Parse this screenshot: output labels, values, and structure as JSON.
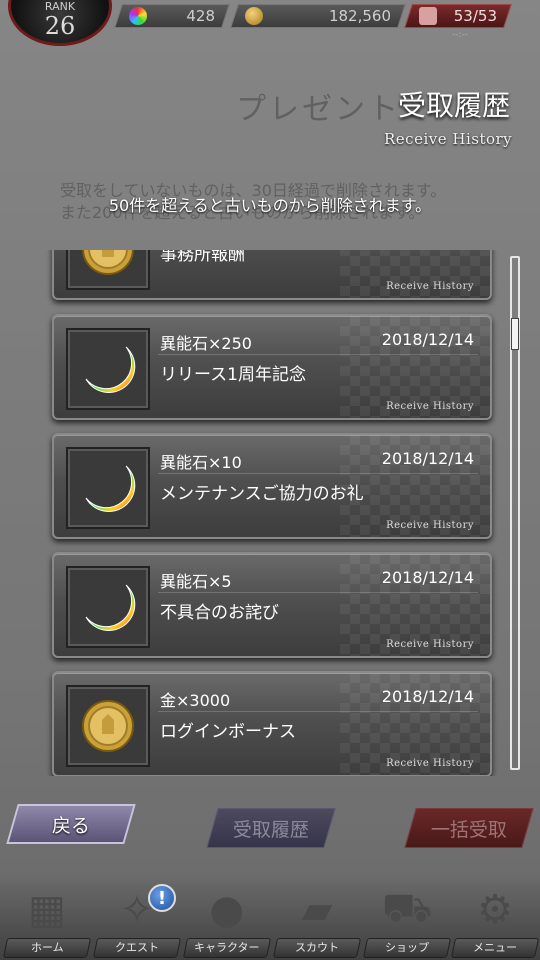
{
  "status": {
    "rank_label": "RANK",
    "rank_value": "26",
    "stones": "428",
    "gold": "182,560",
    "stamina": "53/53",
    "stamina_timer": "--:--"
  },
  "header": {
    "ghost_title": "プレゼント",
    "title": "受取履歴",
    "subtitle": "Receive History",
    "ghost_notice_line1": "受取をしていないものは、30日経過で削除されます。",
    "ghost_notice_line2": "また200件を超えると古いものから削除されます。",
    "notice": "50件を超えると古いものから削除されます。"
  },
  "history": [
    {
      "item": "",
      "date": "",
      "description": "事務所報酬",
      "footer": "Receive History",
      "icon": "gold-coin"
    },
    {
      "item": "異能石×250",
      "date": "2018/12/14",
      "description": "リリース1周年記念",
      "footer": "Receive History",
      "icon": "rainbow-moon"
    },
    {
      "item": "異能石×10",
      "date": "2018/12/14",
      "description": "メンテナンスご協力のお礼",
      "footer": "Receive History",
      "icon": "rainbow-moon"
    },
    {
      "item": "異能石×5",
      "date": "2018/12/14",
      "description": "不具合のお詫び",
      "footer": "Receive History",
      "icon": "rainbow-moon"
    },
    {
      "item": "金×3000",
      "date": "2018/12/14",
      "description": "ログインボーナス",
      "footer": "Receive History",
      "icon": "gold-coin"
    }
  ],
  "buttons": {
    "back": "戻る",
    "history": "受取履歴",
    "receive_all": "一括受取"
  },
  "nav": {
    "home": "ホーム",
    "quest": "クエスト",
    "character": "キャラクター",
    "scout": "スカウト",
    "shop": "ショップ",
    "menu": "メニュー",
    "quest_badge": "!"
  },
  "colors": {
    "back_button": "#6f688c",
    "receive_all_button": "#5a2020",
    "stamina_bar": "#7a2a2a"
  }
}
